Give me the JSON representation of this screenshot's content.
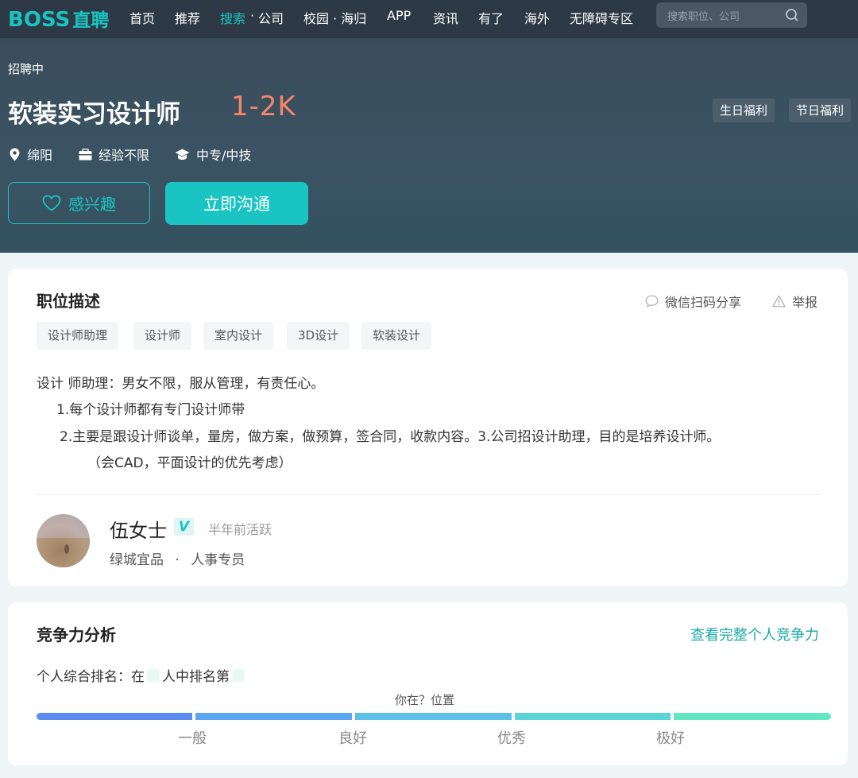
{
  "nav": {
    "logo_main": "BOSS",
    "logo_sub": "直聘",
    "items": [
      "首页",
      "推荐",
      "搜索",
      "公司",
      "校园 · 海归",
      "APP",
      "资讯",
      "有了",
      "海外",
      "无障碍专区"
    ],
    "separator": "·",
    "search_placeholder": "搜索职位、公司"
  },
  "job": {
    "status": "招聘中",
    "title": "软装实习设计师",
    "salary": "1-2K",
    "benefits": [
      "生日福利",
      "节日福利"
    ],
    "location": "绵阳",
    "experience": "经验不限",
    "education": "中专/中技",
    "interest_label": "感兴趣",
    "chat_label": "立即沟通"
  },
  "description": {
    "title": "职位描述",
    "share_label": "微信扫码分享",
    "report_label": "举报",
    "tags": [
      "设计师助理",
      "设计师",
      "室内设计",
      "3D设计",
      "软装设计"
    ],
    "lines": [
      "设计 师助理：男女不限，服从管理，有责任心。",
      "1.每个设计师都有专门设计师带",
      "2.主要是跟设计师谈单，量房，做方案，做预算，签合同，收款内容。3.公司招设计助理，目的是培养设计师。",
      "（会CAD，平面设计的优先考虑）"
    ]
  },
  "recruiter": {
    "name": "伍女士",
    "badge": "V",
    "active": "半年前活跃",
    "company": "绿城宜品",
    "dot": "·",
    "role": "人事专员"
  },
  "competition": {
    "title": "竞争力分析",
    "link": "查看完整个人竞争力",
    "rank_prefix": "个人综合排名：在",
    "rank_middle": "人中排名第",
    "position_label": "你在？位置",
    "levels": [
      "一般",
      "良好",
      "优秀",
      "极好"
    ]
  },
  "colors": {
    "accent": "#19c4c2",
    "salary": "#f5866a",
    "nav_bg": "#2d3a45",
    "hero_bg": "#3a5363"
  }
}
